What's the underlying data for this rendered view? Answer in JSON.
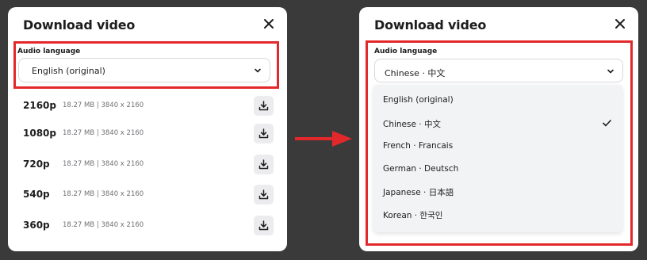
{
  "left": {
    "title": "Download video",
    "audio_label": "Audio language",
    "selected_language": "English (original)",
    "resolutions": [
      {
        "name": "2160p",
        "meta": "18.27 MB | 3840 x 2160"
      },
      {
        "name": "1080p",
        "meta": "18.27 MB | 3840 x 2160"
      },
      {
        "name": "720p",
        "meta": "18.27 MB | 3840 x 2160"
      },
      {
        "name": "540p",
        "meta": "18.27 MB | 3840 x 2160"
      },
      {
        "name": "360p",
        "meta": "18.27 MB | 3840 x 2160"
      }
    ]
  },
  "right": {
    "title": "Download video",
    "audio_label": "Audio language",
    "selected_language": "Chinese · 中文",
    "menu_items": [
      {
        "label": "English (original)",
        "checked": false
      },
      {
        "label": "Chinese · 中文",
        "checked": true
      },
      {
        "label": "French · Francais",
        "checked": false
      },
      {
        "label": "German · Deutsch",
        "checked": false
      },
      {
        "label": "Japanese · 日本語",
        "checked": false
      },
      {
        "label": "Korean · 한국인",
        "checked": false
      }
    ]
  },
  "colors": {
    "highlight": "#e3282b",
    "background": "#3a3a3a",
    "dialog": "#ffffff",
    "menu": "#f2f3f5"
  },
  "icons": [
    "close-icon",
    "chevron-down-icon",
    "download-icon",
    "check-icon",
    "arrow-right-icon"
  ]
}
